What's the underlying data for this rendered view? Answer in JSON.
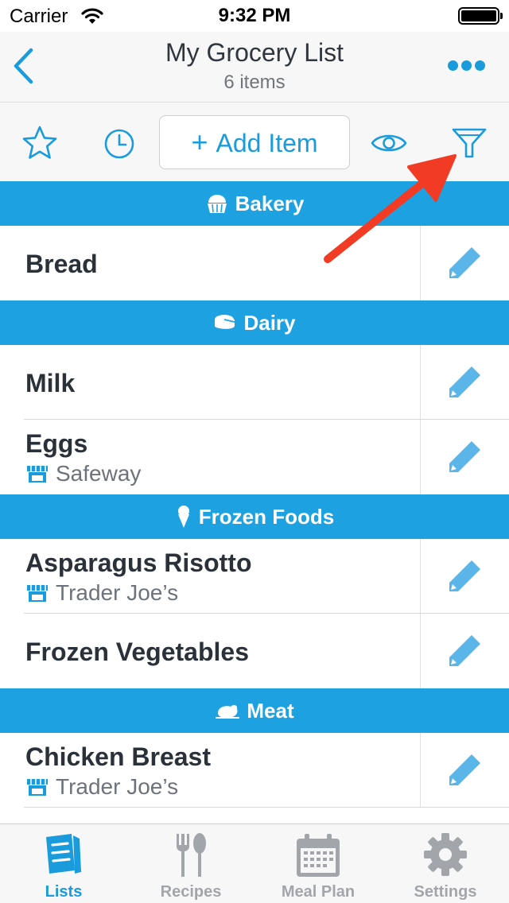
{
  "status_bar": {
    "carrier": "Carrier",
    "time": "9:32 PM"
  },
  "nav": {
    "title": "My Grocery List",
    "subtitle": "6 items"
  },
  "toolbar": {
    "add_item_label": "Add Item",
    "add_item_plus": "+"
  },
  "sections": [
    {
      "name": "Bakery",
      "icon": "cake-icon",
      "items": [
        {
          "name": "Bread",
          "store": ""
        }
      ]
    },
    {
      "name": "Dairy",
      "icon": "cheese-icon",
      "items": [
        {
          "name": "Milk",
          "store": ""
        },
        {
          "name": "Eggs",
          "store": "Safeway"
        }
      ]
    },
    {
      "name": "Frozen Foods",
      "icon": "ice-cream-icon",
      "items": [
        {
          "name": "Asparagus Risotto",
          "store": "Trader Joe’s"
        },
        {
          "name": "Frozen Vegetables",
          "store": ""
        }
      ]
    },
    {
      "name": "Meat",
      "icon": "poultry-icon",
      "items": [
        {
          "name": "Chicken Breast",
          "store": "Trader Joe’s"
        }
      ]
    }
  ],
  "tabs": [
    {
      "label": "Lists",
      "icon": "list-icon",
      "active": true
    },
    {
      "label": "Recipes",
      "icon": "fork-spoon-icon",
      "active": false
    },
    {
      "label": "Meal Plan",
      "icon": "calendar-icon",
      "active": false
    },
    {
      "label": "Settings",
      "icon": "gear-icon",
      "active": false
    }
  ],
  "colors": {
    "accent": "#1a9bdc",
    "section_header": "#1da1e0",
    "annotation_arrow": "#f23b24"
  }
}
